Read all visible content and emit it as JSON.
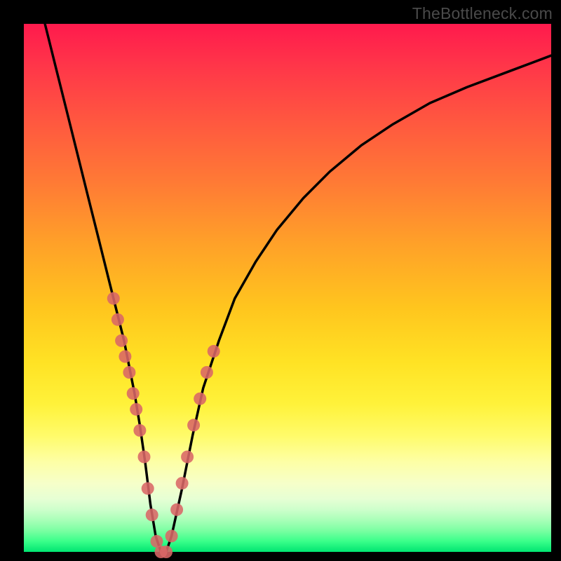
{
  "attribution": "TheBottleneck.com",
  "chart_data": {
    "type": "line",
    "title": "",
    "xlabel": "",
    "ylabel": "",
    "xlim": [
      0,
      100
    ],
    "ylim": [
      0,
      100
    ],
    "grid": false,
    "legend": false,
    "series": [
      {
        "name": "bottleneck-curve",
        "x": [
          4,
          6,
          8,
          10,
          12,
          14,
          16,
          18,
          19,
          20,
          21,
          22,
          23,
          24,
          25,
          26,
          27,
          28,
          30,
          32,
          34,
          37,
          40,
          44,
          48,
          53,
          58,
          64,
          70,
          77,
          84,
          92,
          100
        ],
        "y": [
          100,
          92,
          84,
          76,
          68,
          60,
          52,
          44,
          40,
          35,
          30,
          24,
          17,
          9,
          3,
          0,
          0,
          3,
          12,
          22,
          31,
          40,
          48,
          55,
          61,
          67,
          72,
          77,
          81,
          85,
          88,
          91,
          94
        ]
      }
    ],
    "scatter_points": {
      "name": "marker-dots",
      "x": [
        17.0,
        17.8,
        18.5,
        19.2,
        20.0,
        20.7,
        21.3,
        22.0,
        22.8,
        23.5,
        24.3,
        25.2,
        26.0,
        27.0,
        28.0,
        29.0,
        30.0,
        31.0,
        32.2,
        33.4,
        34.7,
        36.0
      ],
      "y": [
        48,
        44,
        40,
        37,
        34,
        30,
        27,
        23,
        18,
        12,
        7,
        2,
        0,
        0,
        3,
        8,
        13,
        18,
        24,
        29,
        34,
        38
      ]
    },
    "gradient_bands": [
      {
        "pos": 0,
        "color": "#ff1a4d"
      },
      {
        "pos": 18,
        "color": "#ff5640"
      },
      {
        "pos": 42,
        "color": "#ffa228"
      },
      {
        "pos": 72,
        "color": "#fff23a"
      },
      {
        "pos": 90,
        "color": "#e6ffd4"
      },
      {
        "pos": 100,
        "color": "#00e571"
      }
    ]
  }
}
